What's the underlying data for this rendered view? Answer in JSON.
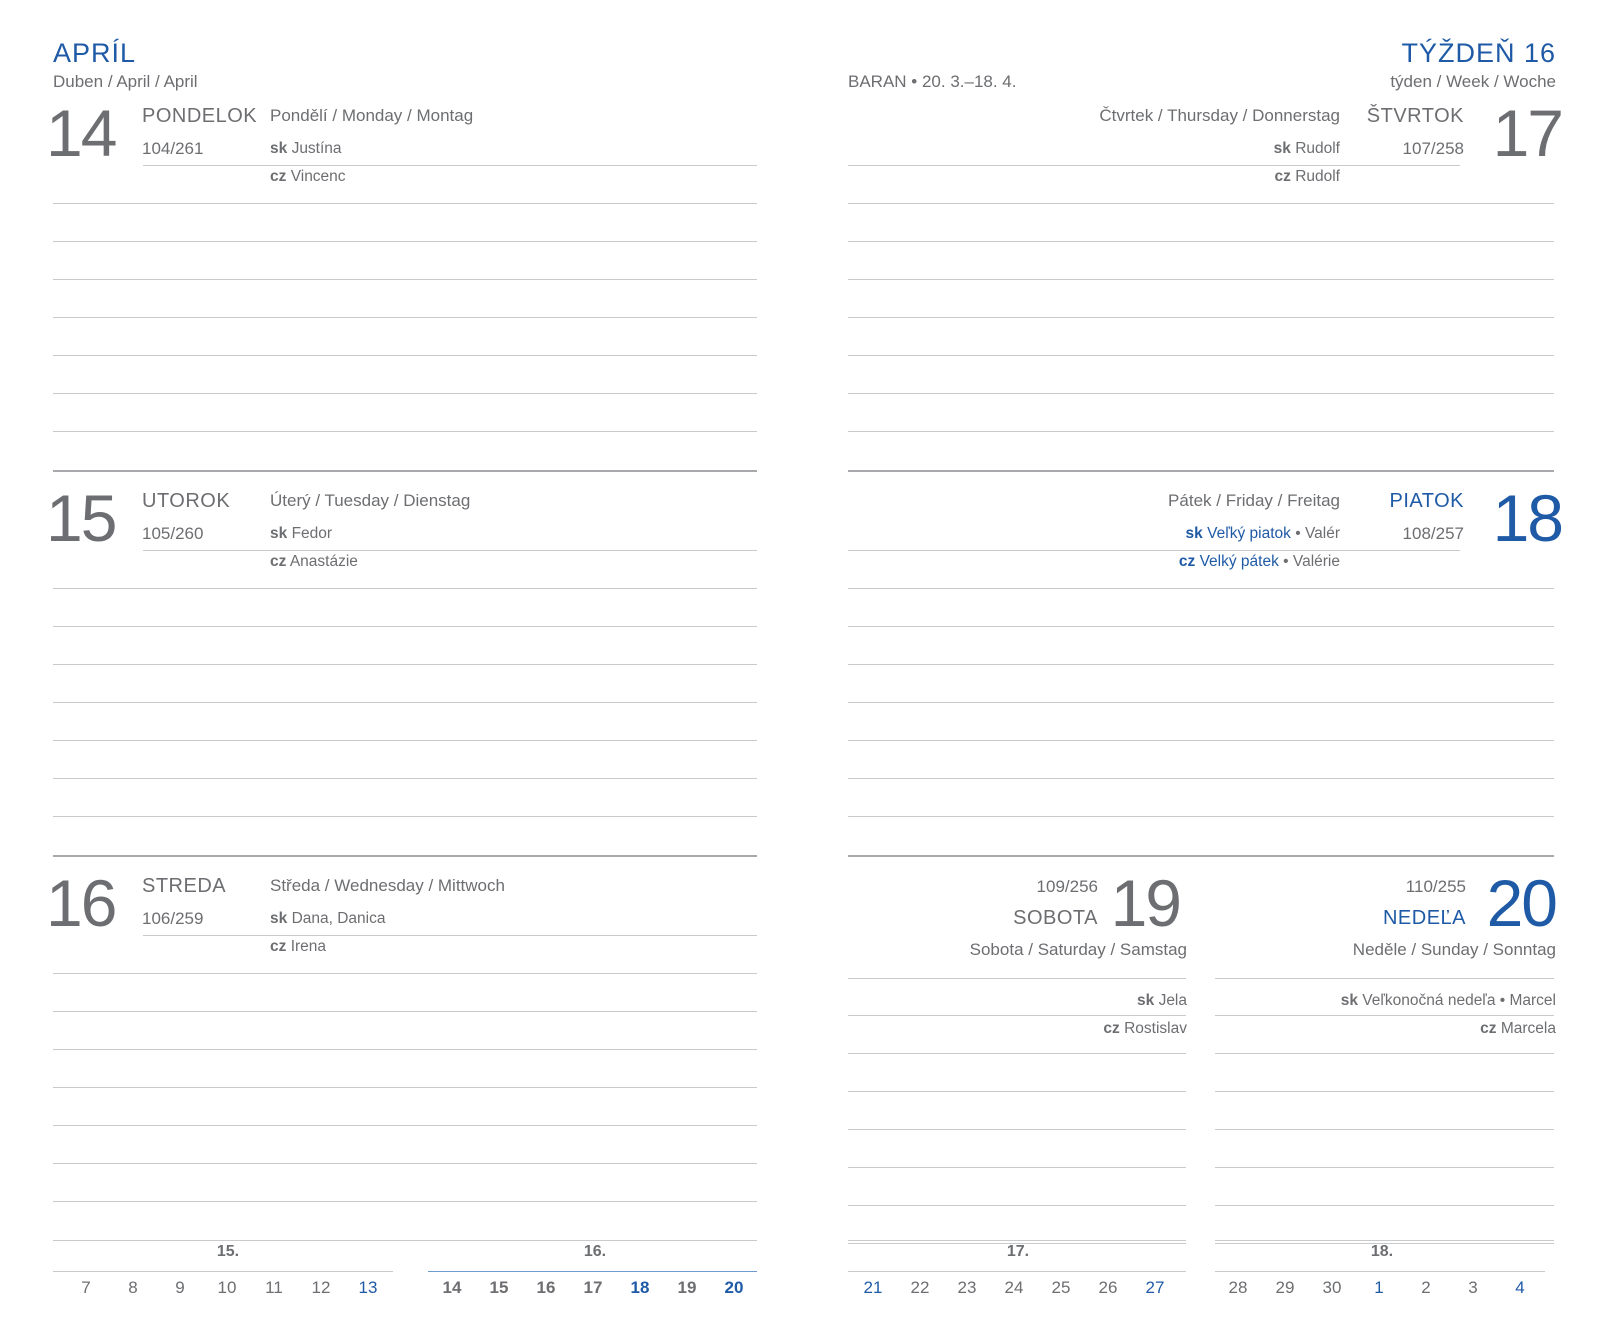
{
  "header": {
    "month_title": "APRÍL",
    "month_subtitle": "Duben / April / April",
    "week_title": "TÝŽDEŇ 16",
    "week_subtitle": "týden / Week / Woche",
    "zodiac": "BARAN • 20. 3.–18. 4."
  },
  "days": {
    "d14": {
      "num": "14",
      "name": "PONDELOK",
      "daynum": "104/261",
      "langs": "Pondělí / Monday / Montag",
      "sk_label": "sk",
      "sk": "Justína",
      "cz_label": "cz",
      "cz": "Vincenc"
    },
    "d15": {
      "num": "15",
      "name": "UTOROK",
      "daynum": "105/260",
      "langs": "Úterý / Tuesday / Dienstag",
      "sk_label": "sk",
      "sk": "Fedor",
      "cz_label": "cz",
      "cz": "Anastázie"
    },
    "d16": {
      "num": "16",
      "name": "STREDA",
      "daynum": "106/259",
      "langs": "Středa / Wednesday / Mittwoch",
      "sk_label": "sk",
      "sk": "Dana, Danica",
      "cz_label": "cz",
      "cz": "Irena"
    },
    "d17": {
      "num": "17",
      "name": "ŠTVRTOK",
      "daynum": "107/258",
      "langs": "Čtvrtek / Thursday / Donnerstag",
      "sk_label": "sk",
      "sk": "Rudolf",
      "cz_label": "cz",
      "cz": "Rudolf"
    },
    "d18": {
      "num": "18",
      "name": "PIATOK",
      "daynum": "108/257",
      "langs": "Pátek / Friday / Freitag",
      "sk_label": "sk",
      "sk_holiday": "Veľký piatok",
      "sk_sep": " • ",
      "sk": "Valér",
      "cz_label": "cz",
      "cz_holiday": "Velký pátek",
      "cz_sep": " • ",
      "cz": "Valérie"
    },
    "d19": {
      "num": "19",
      "name": "SOBOTA",
      "daynum": "109/256",
      "langs": "Sobota / Saturday / Samstag",
      "sk_label": "sk",
      "sk": "Jela",
      "cz_label": "cz",
      "cz": "Rostislav"
    },
    "d20": {
      "num": "20",
      "name": "NEDEĽA",
      "daynum": "110/255",
      "langs": "Neděle / Sunday / Sonntag",
      "sk_label": "sk",
      "sk": "Veľkonočná nedeľa • Marcel",
      "cz_label": "cz",
      "cz": "Marcela"
    }
  },
  "mini_calendar": {
    "weeks": [
      {
        "label": "15.",
        "days": [
          "7",
          "8",
          "9",
          "10",
          "11",
          "12",
          "13"
        ]
      },
      {
        "label": "16.",
        "days": [
          "14",
          "15",
          "16",
          "17",
          "18",
          "19",
          "20"
        ]
      },
      {
        "label": "17.",
        "days": [
          "21",
          "22",
          "23",
          "24",
          "25",
          "26",
          "27"
        ]
      },
      {
        "label": "18.",
        "days": [
          "28",
          "29",
          "30",
          "1",
          "2",
          "3",
          "4"
        ]
      }
    ]
  },
  "colors": {
    "accent": "#1f5aa6",
    "text": "#6d6e71",
    "rule": "#c9cacc"
  }
}
